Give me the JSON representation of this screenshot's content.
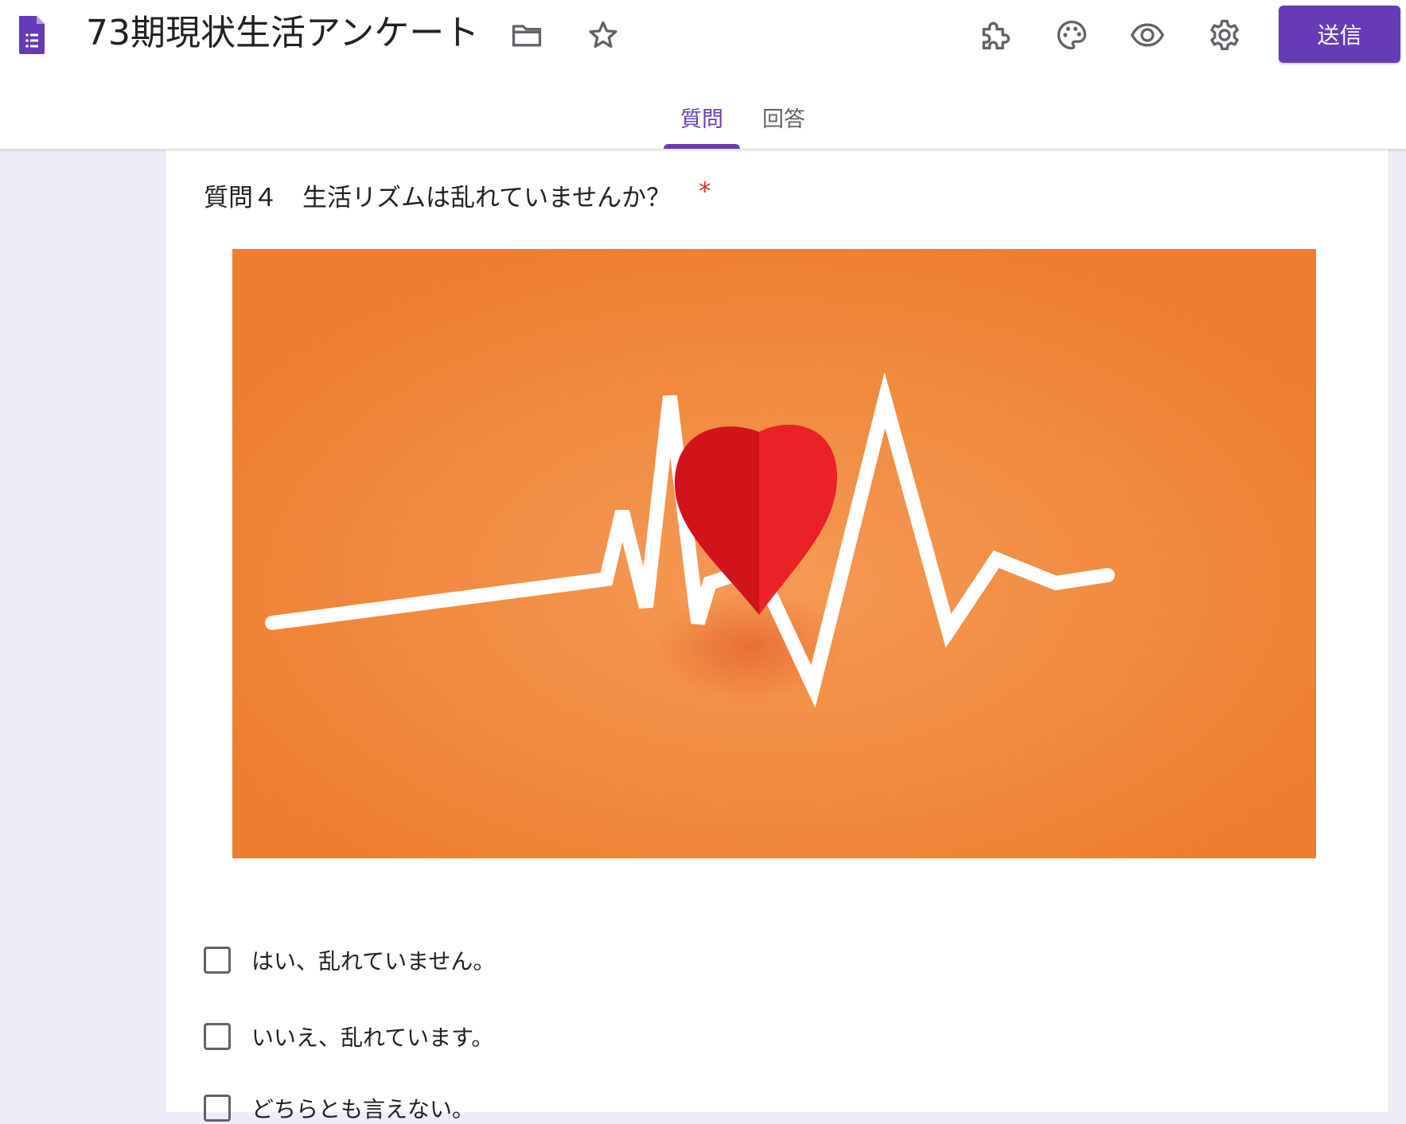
{
  "header": {
    "title": "73期現状生活アンケート",
    "send_label": "送信",
    "icons": [
      "folder-icon",
      "star-icon",
      "addon-icon",
      "palette-icon",
      "preview-icon",
      "settings-icon"
    ]
  },
  "tabs": [
    {
      "label": "質問",
      "active": true
    },
    {
      "label": "回答",
      "active": false
    }
  ],
  "question": {
    "title": "質問４　生活リズムは乱れていませんか？",
    "required_mark": "*",
    "image_description": "heart-with-heartbeat-line",
    "options": [
      {
        "label": "はい、乱れていません。"
      },
      {
        "label": "いいえ、乱れています。"
      },
      {
        "label": "どちらとも言えない。"
      }
    ]
  },
  "colors": {
    "accent": "#673ab7",
    "background": "#f0ebf8",
    "required": "#d93025",
    "image_orange": "#f08033",
    "heart_red": "#e31e24"
  }
}
